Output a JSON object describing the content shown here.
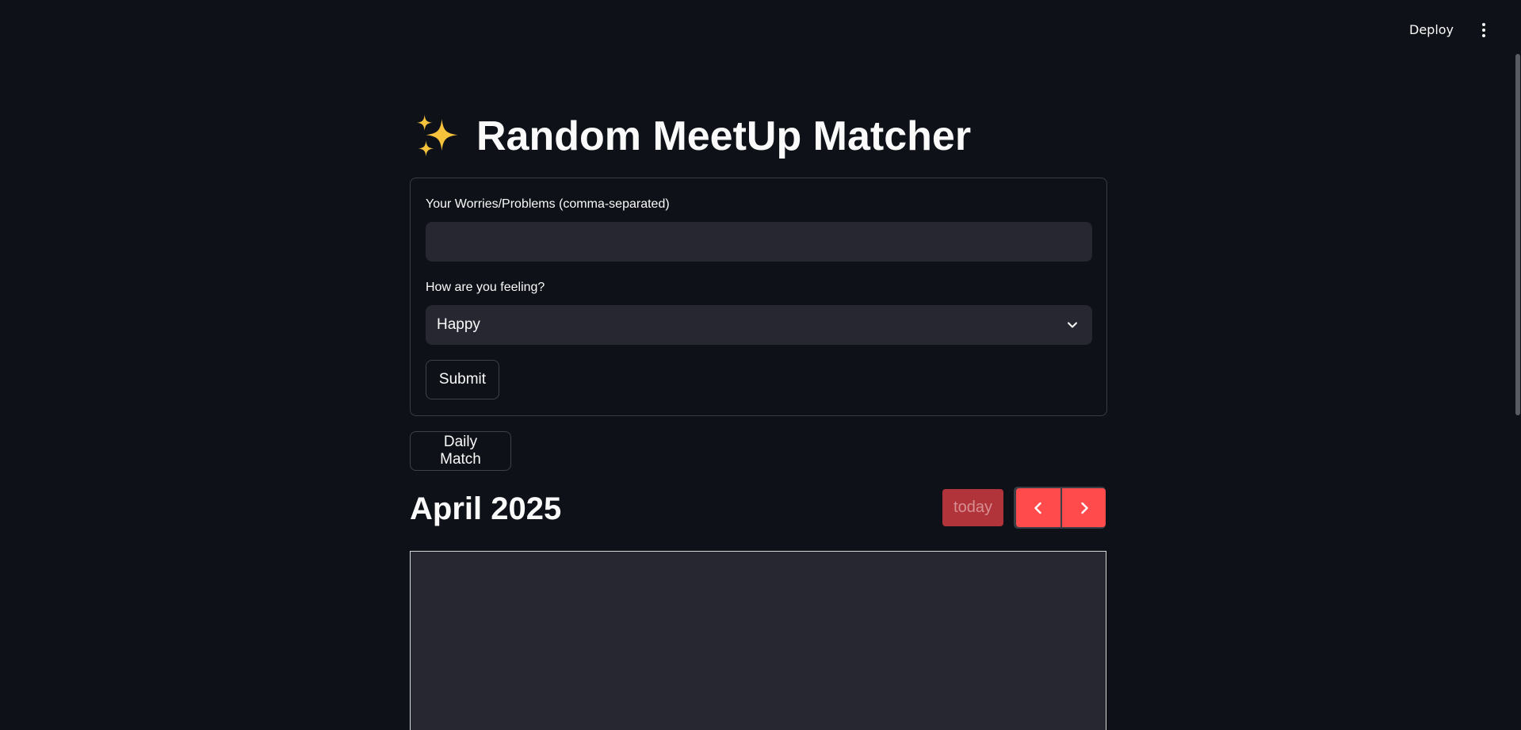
{
  "header": {
    "deploy_label": "Deploy",
    "menu_icon": "vertical-ellipsis-icon"
  },
  "app": {
    "title_icon": "sparkles-icon",
    "title": "Random MeetUp Matcher"
  },
  "form": {
    "worries_label": "Your Worries/Problems (comma-separated)",
    "worries_value": "",
    "worries_placeholder": "",
    "feeling_label": "How are you feeling?",
    "feeling_value": "Happy",
    "submit_label": "Submit"
  },
  "daily_match_label": "Daily Match",
  "calendar": {
    "title": "April 2025",
    "today_label": "today",
    "prev_icon": "chevron-left-icon",
    "next_icon": "chevron-right-icon",
    "today_color": "#b0343a",
    "nav_color": "#ff4b4b"
  },
  "colors": {
    "background": "#0e1117",
    "input_background": "#262730",
    "accent": "#ff4b4b"
  }
}
